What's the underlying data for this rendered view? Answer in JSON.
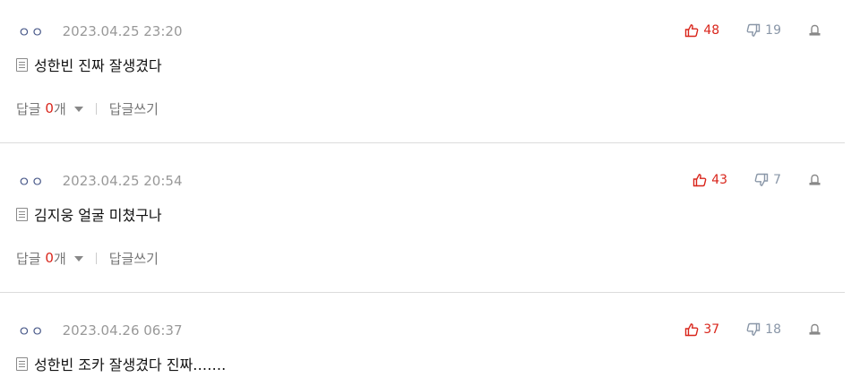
{
  "comments": [
    {
      "nickname": "ㅇㅇ",
      "date": "2023.04.25 23:20",
      "text": "성한빈 진짜 잘생겼다",
      "likes": "48",
      "dislikes": "19",
      "reply_label": "답글",
      "reply_count": "0",
      "reply_unit": "개",
      "write_reply_label": "답글쓰기"
    },
    {
      "nickname": "ㅇㅇ",
      "date": "2023.04.25 20:54",
      "text": "김지웅 얼굴 미쳤구나",
      "likes": "43",
      "dislikes": "7",
      "reply_label": "답글",
      "reply_count": "0",
      "reply_unit": "개",
      "write_reply_label": "답글쓰기"
    },
    {
      "nickname": "ㅇㅇ",
      "date": "2023.04.26 06:37",
      "text": "성한빈 조카 잘생겼다 진짜…….",
      "likes": "37",
      "dislikes": "18"
    }
  ],
  "icons": {
    "like": "thumbs-up-icon",
    "dislike": "thumbs-down-icon",
    "report": "report-icon",
    "document": "document-icon",
    "caret": "caret-down-icon"
  },
  "colors": {
    "like": "#d9261c",
    "dislike": "#8a97a8",
    "reply_count": "#d9261c",
    "nickname": "#4a5a8a",
    "date": "#999999"
  }
}
